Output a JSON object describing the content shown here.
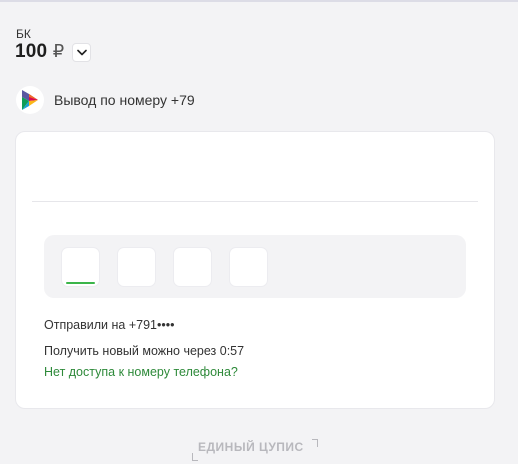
{
  "balance": {
    "label": "БК",
    "amount": "100",
    "currency": "₽"
  },
  "method": {
    "logo_icon": "sbp-logo-icon",
    "text": "Вывод по номеру +79"
  },
  "code_input": {
    "cells": 4,
    "active_index": 0
  },
  "messages": {
    "sent": "Отправили на +791••••",
    "resend": "Получить новый можно через 0:57",
    "no_access": "Нет доступа к номеру телефона?"
  },
  "footer": {
    "cupis": "ЕДИНЫЙ ЦУПИС"
  },
  "colors": {
    "accent_green": "#3bb54a",
    "link_green": "#2e8a3a",
    "background": "#f3f3f5"
  }
}
